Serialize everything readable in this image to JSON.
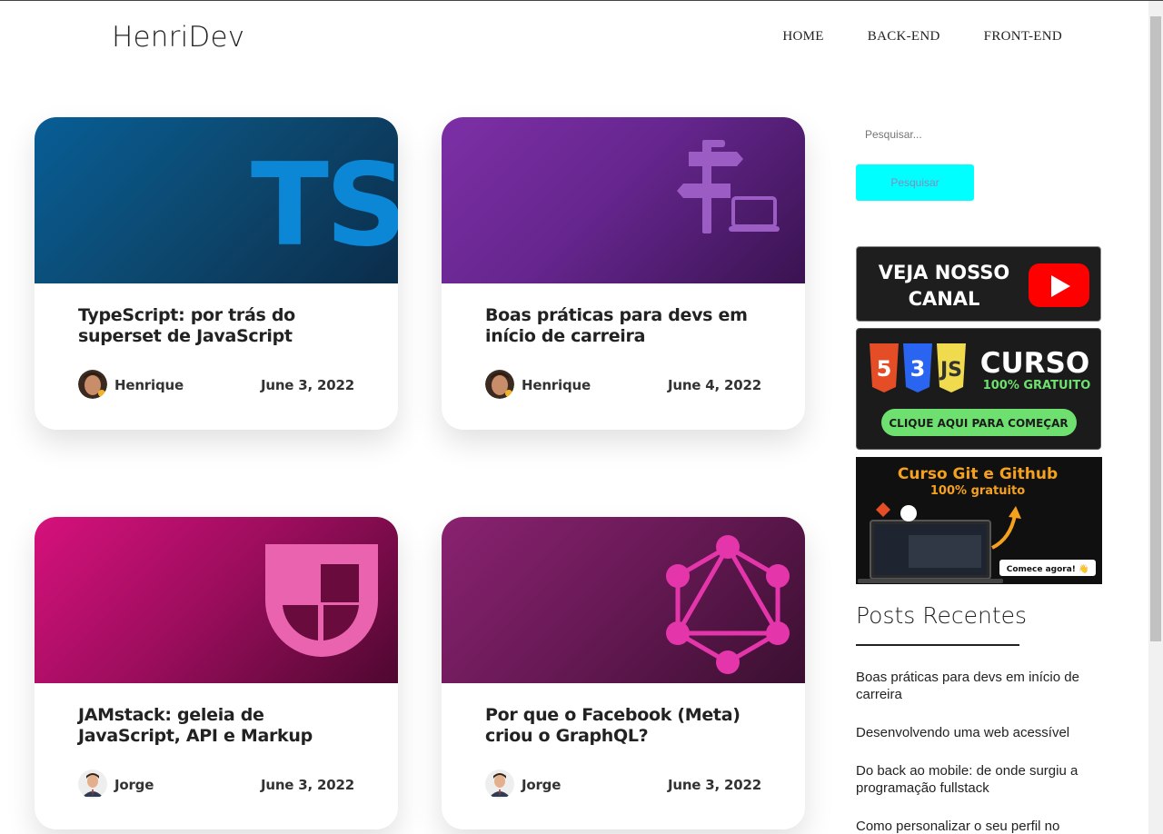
{
  "header": {
    "logo": "HenriDev",
    "nav": [
      "HOME",
      "BACK-END",
      "FRONT-END"
    ]
  },
  "posts": [
    {
      "title": "TypeScript: por trás do superset de JavaScript",
      "author": "Henrique",
      "date": "June 3, 2022",
      "image_label": "TS",
      "image_icon": "typescript-logo-icon"
    },
    {
      "title": "Boas práticas para devs em início de carreira",
      "author": "Henrique",
      "date": "June 4, 2022",
      "image_icon": "signpost-laptop-icon"
    },
    {
      "title": "JAMstack: geleia de JavaScript, API e Markup",
      "author": "Jorge",
      "date": "June 3, 2022",
      "image_icon": "jamstack-logo-icon"
    },
    {
      "title": "Por que o Facebook (Meta) criou o GraphQL?",
      "author": "Jorge",
      "date": "June 3, 2022",
      "image_icon": "graphql-logo-icon"
    }
  ],
  "sidebar": {
    "search_placeholder": "Pesquisar...",
    "search_button": "Pesquisar",
    "banners": {
      "youtube": {
        "line1": "VEJA NOSSO",
        "line2": "CANAL"
      },
      "curso": {
        "title": "CURSO",
        "subtitle": "100% GRATUITO",
        "cta": "CLIQUE AQUI PARA COMEÇAR"
      },
      "git": {
        "title": "Curso Git e Github",
        "subtitle": "100% gratuito",
        "cta": "Comece agora! 👋"
      }
    },
    "recent_title": "Posts Recentes",
    "recent_posts": [
      "Boas práticas para devs em início de carreira",
      "Desenvolvendo uma web acessível",
      "Do back ao mobile: de onde surgiu a programação fullstack",
      "Como personalizar o seu perfil no"
    ]
  },
  "colors": {
    "search_button_bg": "#00ffff",
    "ts_blue": "#0b87d6",
    "jam_pink": "#ea63ae",
    "gql_pink": "#e535ab",
    "dev_purple": "#9b5cc4",
    "green_cta": "#6ee06f",
    "orange": "#f5a11e"
  }
}
